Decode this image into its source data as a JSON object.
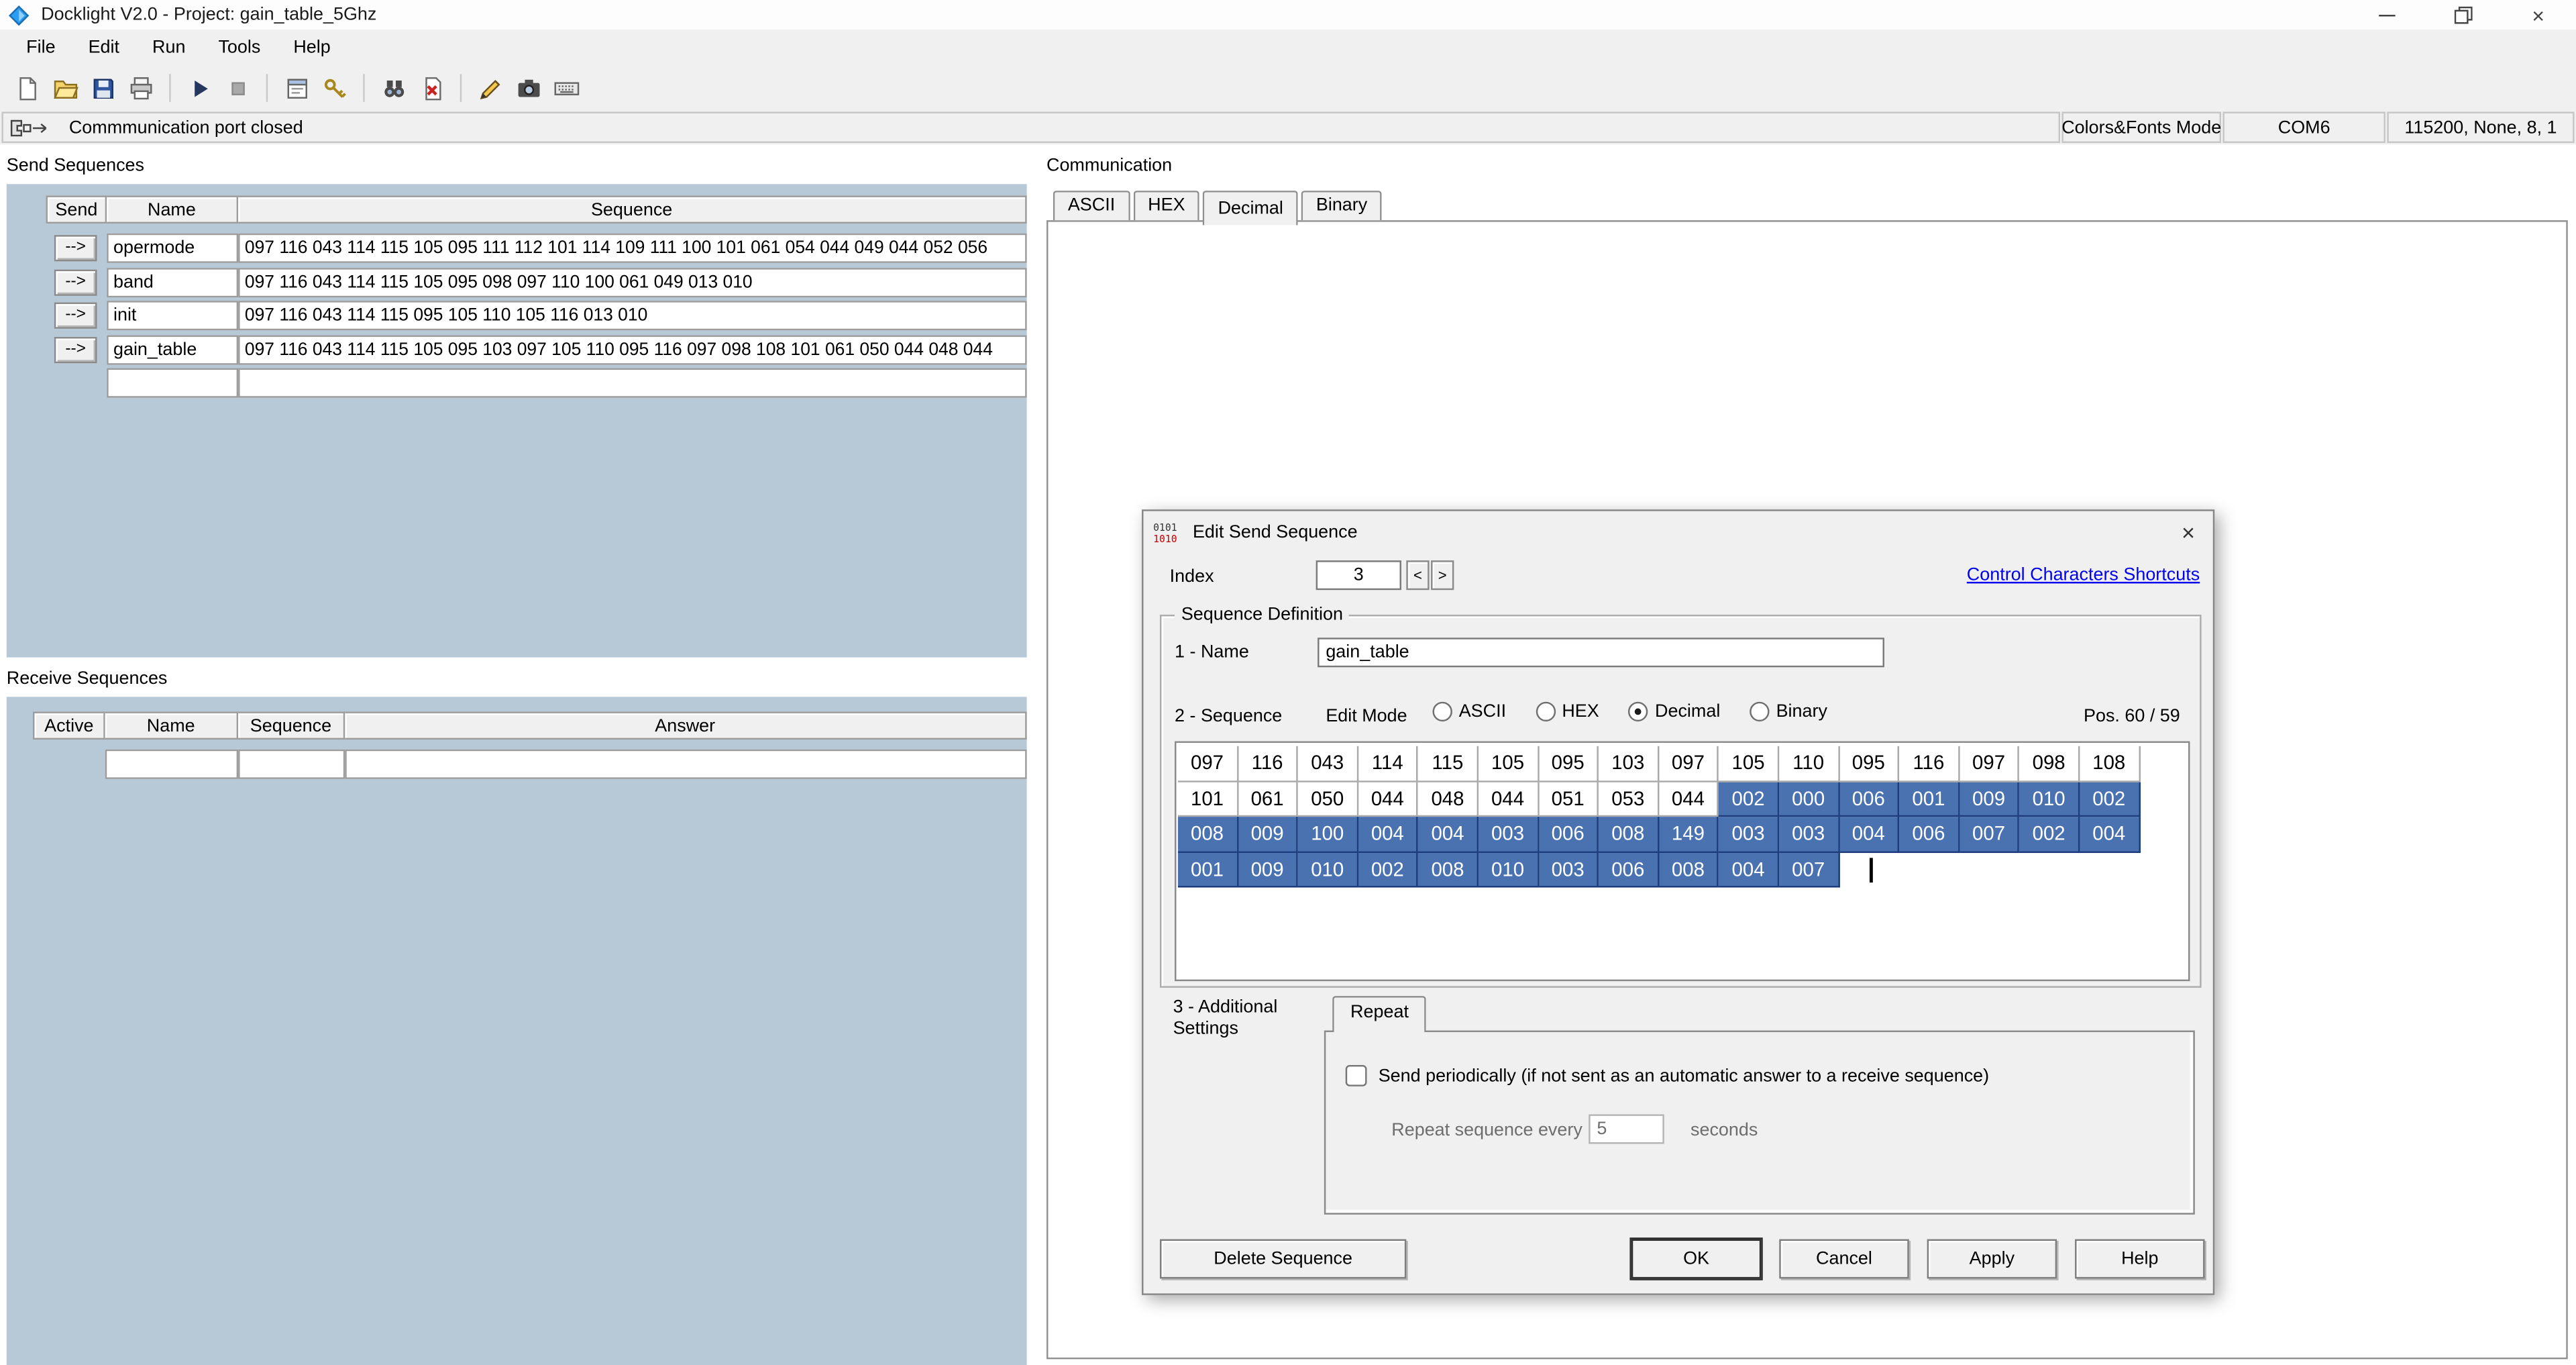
{
  "window": {
    "title": "Docklight V2.0 - Project: gain_table_5Ghz"
  },
  "menu": {
    "items": [
      "File",
      "Edit",
      "Run",
      "Tools",
      "Help"
    ]
  },
  "toolbar": {
    "groups": [
      [
        "new-file-icon",
        "open-project-icon",
        "save-project-icon",
        "print-icon"
      ],
      [
        "start-communication-icon",
        "stop-communication-icon"
      ],
      [
        "project-settings-icon",
        "keys-icon"
      ],
      [
        "find-sequence-icon",
        "stop-filter-icon"
      ],
      [
        "edit-icon",
        "snapshot-icon",
        "keyboard-console-icon"
      ]
    ]
  },
  "statusbar": {
    "message": "Commmunication port closed",
    "mode": "Colors&Fonts Mode",
    "port": "COM6",
    "parameters": "115200, None, 8, 1"
  },
  "send_sequences": {
    "title": "Send Sequences",
    "columns": [
      "Send",
      "Name",
      "Sequence"
    ],
    "send_button_label": "-->",
    "rows": [
      {
        "name": "opermode",
        "sequence": "097 116 043 114 115 105 095 111 112 101 114 109 111 100 101 061 054 044 049 044 052 056"
      },
      {
        "name": "band",
        "sequence": "097 116 043 114 115 105 095 098 097 110 100 061 049 013 010"
      },
      {
        "name": "init",
        "sequence": "097 116 043 114 115 095 105 110 105 116 013 010"
      },
      {
        "name": "gain_table",
        "sequence": "097 116 043 114 115 105 095 103 097 105 110 095 116 097 098 108 101 061 050 044 048 044"
      }
    ]
  },
  "receive_sequences": {
    "title": "Receive Sequences",
    "columns": [
      "Active",
      "Name",
      "Sequence",
      "Answer"
    ]
  },
  "communication": {
    "title": "Communication",
    "tabs": [
      "ASCII",
      "HEX",
      "Decimal",
      "Binary"
    ],
    "active_tab": "Decimal"
  },
  "dialog": {
    "title": "Edit Send Sequence",
    "index_label": "Index",
    "index_value": "3",
    "link_label": "Control Characters Shortcuts",
    "group_title": "Sequence Definition",
    "name_label": "1 - Name",
    "name_value": "gain_table",
    "sequence_label": "2 - Sequence",
    "edit_mode_label": "Edit Mode",
    "edit_modes": [
      "ASCII",
      "HEX",
      "Decimal",
      "Binary"
    ],
    "selected_mode": "Decimal",
    "pos_label": "Pos. 60 / 59",
    "grid": {
      "rows": [
        {
          "cells": [
            "097",
            "116",
            "043",
            "114",
            "115",
            "105",
            "095",
            "103",
            "097",
            "105",
            "110",
            "095",
            "116",
            "097",
            "098",
            "108"
          ],
          "selected_from": null
        },
        {
          "cells": [
            "101",
            "061",
            "050",
            "044",
            "048",
            "044",
            "051",
            "053",
            "044",
            "002",
            "000",
            "006",
            "001",
            "009",
            "010",
            "002"
          ],
          "selected_from": 9
        },
        {
          "cells": [
            "008",
            "009",
            "100",
            "004",
            "004",
            "003",
            "006",
            "008",
            "149",
            "003",
            "003",
            "004",
            "006",
            "007",
            "002",
            "004"
          ],
          "selected_from": 0
        },
        {
          "cells": [
            "001",
            "009",
            "010",
            "002",
            "008",
            "010",
            "003",
            "006",
            "008",
            "004",
            "007"
          ],
          "selected_from": 0,
          "cursor": true
        }
      ]
    },
    "additional_label": "3 - Additional Settings",
    "repeat_tab": "Repeat",
    "periodic_label": "Send periodically  (if not sent as an automatic answer to a receive sequence)",
    "repeat_every_label": "Repeat sequence every",
    "repeat_value": "5",
    "seconds_label": "seconds",
    "buttons": {
      "delete": "Delete Sequence",
      "ok": "OK",
      "cancel": "Cancel",
      "apply": "Apply",
      "help": "Help"
    }
  },
  "colors": {
    "selection": "#4a72b0",
    "panel": "#b7c8d7",
    "link": "#0000ee"
  }
}
